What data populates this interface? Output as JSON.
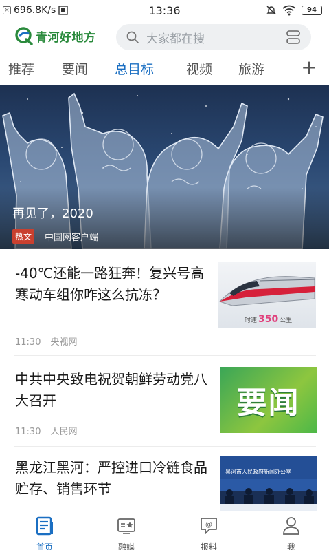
{
  "status_bar": {
    "network_speed": "696.8K/s",
    "time": "13:36",
    "battery": "94"
  },
  "header": {
    "logo_text": "青河好地方",
    "search_placeholder": "大家都在搜"
  },
  "tabs": [
    {
      "label": "推荐",
      "active": false
    },
    {
      "label": "要闻",
      "active": false
    },
    {
      "label": "总目标",
      "active": true
    },
    {
      "label": "视频",
      "active": false
    },
    {
      "label": "旅游",
      "active": false
    }
  ],
  "hero": {
    "title": "再见了，2020",
    "tag": "热文",
    "source": "中国网客户端"
  },
  "news": [
    {
      "title": "-40℃还能一路狂奔！复兴号高寒动车组你咋这么抗冻？",
      "time": "11:30",
      "source": "央视网",
      "thumb_caption_prefix": "时速",
      "thumb_caption_value": "350",
      "thumb_caption_unit": "公里"
    },
    {
      "title": "中共中央致电祝贺朝鲜劳动党八大召开",
      "time": "11:30",
      "source": "人民网",
      "thumb_text": "要闻"
    },
    {
      "title": "黑龙江黑河：严控进口冷链食品贮存、销售环节",
      "thumb_banner": "黑河市人民政府新闻办公室"
    }
  ],
  "bottom_nav": [
    {
      "label": "首页",
      "icon": "news-icon",
      "active": true
    },
    {
      "label": "融媒",
      "icon": "media-icon",
      "active": false
    },
    {
      "label": "报料",
      "icon": "report-icon",
      "active": false
    },
    {
      "label": "我",
      "icon": "profile-icon",
      "active": false
    }
  ],
  "colors": {
    "accent": "#1b6fc2",
    "logo_green": "#2a8a3c",
    "hot_tag": "#c9402f"
  }
}
